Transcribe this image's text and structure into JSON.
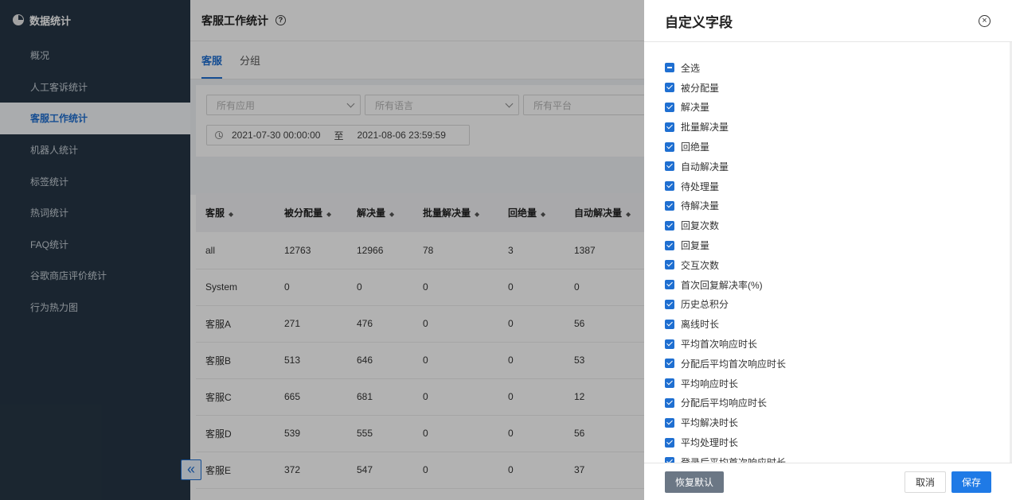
{
  "sidebar": {
    "header": "数据统计",
    "items": [
      {
        "label": "概况"
      },
      {
        "label": "人工客诉统计"
      },
      {
        "label": "客服工作统计"
      },
      {
        "label": "机器人统计"
      },
      {
        "label": "标签统计"
      },
      {
        "label": "热词统计"
      },
      {
        "label": "FAQ统计"
      },
      {
        "label": "谷歌商店评价统计"
      },
      {
        "label": "行为热力图"
      }
    ],
    "active_index": 2,
    "collapse_icon": "double-chevron-left-icon"
  },
  "topbar": {
    "title": "客服工作统计",
    "help_icon": "question-circle-icon"
  },
  "tabs": [
    {
      "label": "客服"
    },
    {
      "label": "分组"
    }
  ],
  "filters": {
    "app_placeholder": "所有应用",
    "lang_placeholder": "所有语言",
    "platform_placeholder": "所有平台",
    "date_start": "2021-07-30 00:00:00",
    "date_sep": "至",
    "date_end": "2021-08-06 23:59:59"
  },
  "table": {
    "headers": [
      "客服",
      "被分配量",
      "解决量",
      "批量解决量",
      "回绝量",
      "自动解决量"
    ],
    "sort_icon": "sort-caret-icon",
    "rows": [
      [
        "all",
        "12763",
        "12966",
        "78",
        "3",
        "1387"
      ],
      [
        "System",
        "0",
        "0",
        "0",
        "0",
        "0"
      ],
      [
        "客服A",
        "271",
        "476",
        "0",
        "0",
        "56"
      ],
      [
        "客服B",
        "513",
        "646",
        "0",
        "0",
        "53"
      ],
      [
        "客服C",
        "665",
        "681",
        "0",
        "0",
        "12"
      ],
      [
        "客服D",
        "539",
        "555",
        "0",
        "0",
        "56"
      ],
      [
        "客服E",
        "372",
        "547",
        "0",
        "0",
        "37"
      ]
    ]
  },
  "drawer": {
    "title": "自定义字段",
    "close_icon": "close-circle-icon",
    "select_all": "全选",
    "fields": [
      "被分配量",
      "解决量",
      "批量解决量",
      "回绝量",
      "自动解决量",
      "待处理量",
      "待解决量",
      "回复次数",
      "回复量",
      "交互次数",
      "首次回复解决率(%)",
      "历史总积分",
      "离线时长",
      "平均首次响应时长",
      "分配后平均首次响应时长",
      "平均响应时长",
      "分配后平均响应时长",
      "平均解决时长",
      "平均处理时长",
      "登录后平均首次响应时长"
    ],
    "reset_label": "恢复默认",
    "cancel_label": "取消",
    "save_label": "保存"
  }
}
